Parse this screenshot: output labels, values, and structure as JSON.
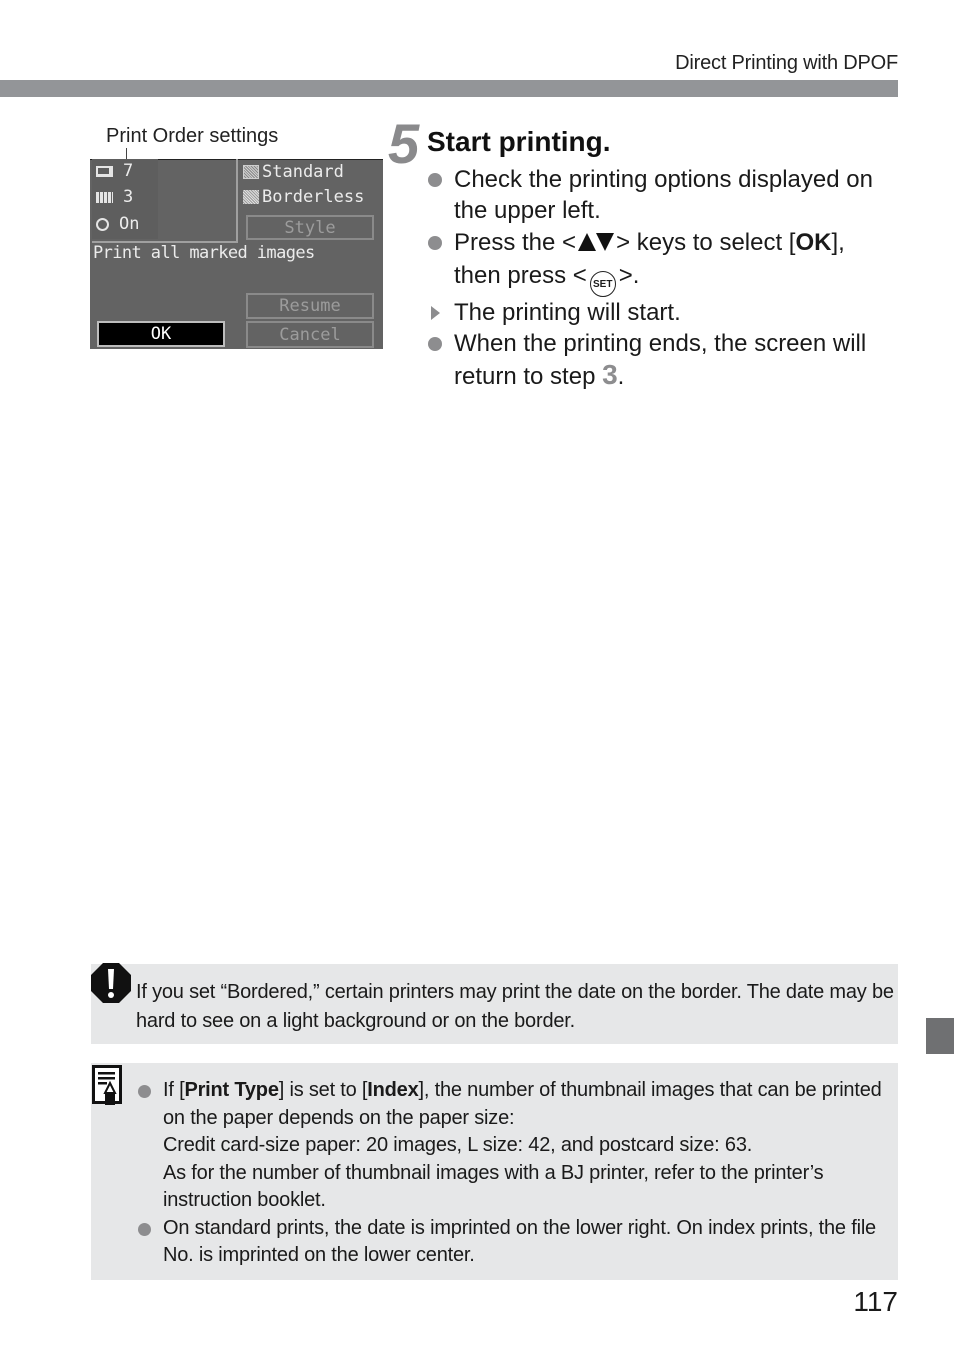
{
  "header": {
    "section_title": "Direct Printing with DPOF"
  },
  "figure": {
    "callout_label": "Print Order settings",
    "lcd": {
      "settings": [
        {
          "icon": "paper-icon",
          "value": "7"
        },
        {
          "icon": "index-icon",
          "value": "3"
        },
        {
          "icon": "clock-icon",
          "value": "On"
        }
      ],
      "options": [
        {
          "icon": "print-type-icon",
          "label": "Standard"
        },
        {
          "icon": "border-icon",
          "label": "Borderless"
        }
      ],
      "style_button": "Style",
      "message": "Print all marked images",
      "ok_button": "OK",
      "resume_button": "Resume",
      "cancel_button": "Cancel"
    }
  },
  "step": {
    "number": "5",
    "title": "Start printing.",
    "items": [
      {
        "type": "bullet",
        "text": "Check the printing options displayed on the upper left."
      },
      {
        "type": "bullet",
        "parts": {
          "a": "Press the <",
          "b": "> keys to select [",
          "ok": "OK",
          "c": "],",
          "d": "then press <",
          "set": "SET",
          "e": ">."
        }
      },
      {
        "type": "result",
        "text": "The printing will start."
      },
      {
        "type": "bullet",
        "text_before": "When the printing ends, the screen will return to step ",
        "step_ref": "3",
        "text_after": "."
      }
    ]
  },
  "caution": {
    "icon": "caution-icon",
    "text": "If you set “Bordered,” certain printers may print the date on the border. The date may be hard to see on a light background or on the border."
  },
  "note": {
    "icon": "memo-icon",
    "items": [
      {
        "prefix": "If [",
        "bold1": "Print Type",
        "mid": "] is set to [",
        "bold2": "Index",
        "suffix": "], the number of thumbnail images that can be printed on the paper depends on the paper size:",
        "line2": "Credit card-size paper: 20 images, L size: 42, and postcard size: 63.",
        "line3": "As for the number of thumbnail images with a BJ printer, refer to the printer’s instruction booklet."
      },
      {
        "text": "On standard prints, the date is imprinted on the lower right. On index prints, the file No. is imprinted on the lower center."
      }
    ]
  },
  "page_number": "117",
  "colors": {
    "header_bar": "#939598",
    "box_background": "#e6e7e8",
    "accent_gray": "#8d8d8f",
    "tab_marker": "#6f7072",
    "lcd_background": "#636363"
  }
}
